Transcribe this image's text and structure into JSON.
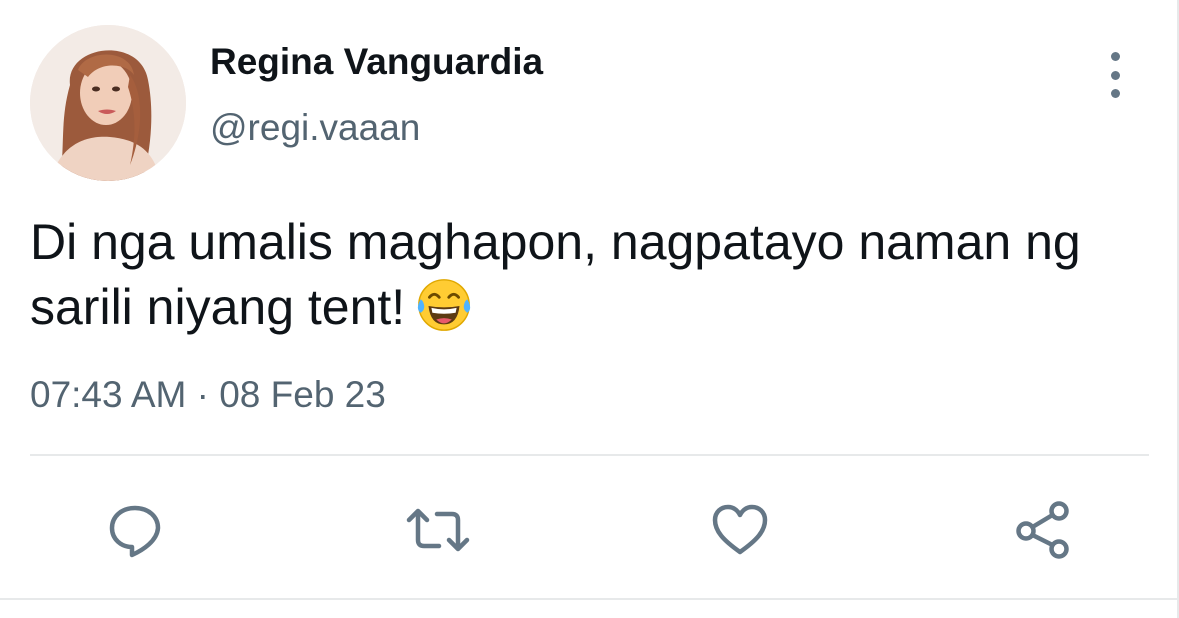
{
  "tweet": {
    "author": {
      "display_name": "Regina Vanguardia",
      "handle": "@regi.vaaan"
    },
    "text": "Di nga umalis maghapon, nagpatayo naman ng sarili niyang tent!",
    "emoji": "face-with-tears-of-joy",
    "timestamp": "07:43 AM · 08 Feb 23"
  },
  "actions": [
    {
      "name": "reply",
      "icon": "speech-bubble-icon"
    },
    {
      "name": "retweet",
      "icon": "retweet-icon"
    },
    {
      "name": "like",
      "icon": "heart-icon"
    },
    {
      "name": "share",
      "icon": "share-icon"
    }
  ],
  "colors": {
    "text_primary": "#0f1419",
    "text_secondary": "#536471",
    "icon_gray": "#657786",
    "divider": "#e7e9ea"
  }
}
